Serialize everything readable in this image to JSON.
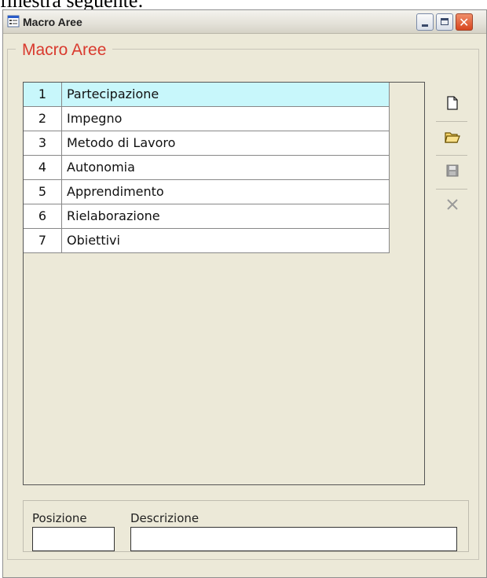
{
  "document_fragment": "finestra seguente:",
  "window": {
    "title": "Macro Aree",
    "buttons": {
      "minimize_icon": "minimize-icon",
      "maximize_icon": "maximize-icon",
      "close_icon": "close-icon"
    }
  },
  "group": {
    "title": "Macro Aree",
    "title_color": "#d93a2e"
  },
  "grid": {
    "selected_row_color": "#c8f7fb",
    "rows": [
      {
        "num": "1",
        "desc": "Partecipazione",
        "selected": true
      },
      {
        "num": "2",
        "desc": "Impegno",
        "selected": false
      },
      {
        "num": "3",
        "desc": "Metodo di Lavoro",
        "selected": false
      },
      {
        "num": "4",
        "desc": "Autonomia",
        "selected": false
      },
      {
        "num": "5",
        "desc": "Apprendimento",
        "selected": false
      },
      {
        "num": "6",
        "desc": "Rielaborazione",
        "selected": false
      },
      {
        "num": "7",
        "desc": "Obiettivi",
        "selected": false
      }
    ]
  },
  "toolbar": [
    {
      "icon": "new-document-icon",
      "enabled": true
    },
    {
      "icon": "open-folder-icon",
      "enabled": true
    },
    {
      "icon": "save-disk-icon",
      "enabled": false
    },
    {
      "icon": "delete-x-icon",
      "enabled": false
    }
  ],
  "form": {
    "posizione_label": "Posizione",
    "posizione_value": "",
    "descrizione_label": "Descrizione",
    "descrizione_value": ""
  }
}
